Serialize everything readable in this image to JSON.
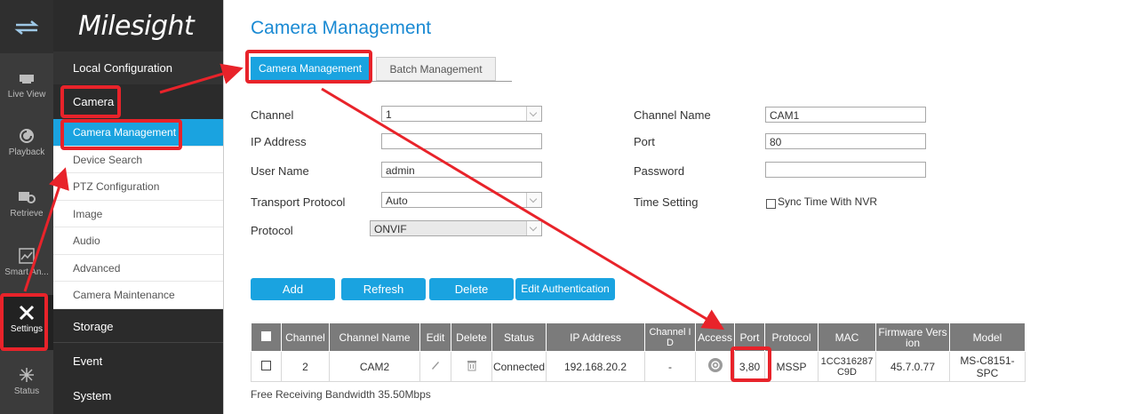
{
  "rail": {
    "items": [
      {
        "label": "Live View",
        "icon": "live-view-icon"
      },
      {
        "label": "Playback",
        "icon": "playback-icon"
      },
      {
        "label": "Retrieve",
        "icon": "retrieve-icon"
      },
      {
        "label": "Smart An...",
        "icon": "smart-analysis-icon"
      },
      {
        "label": "Settings",
        "icon": "settings-icon"
      },
      {
        "label": "Status",
        "icon": "status-icon"
      }
    ]
  },
  "nav": {
    "logo": "Milesight",
    "local_config": "Local Configuration",
    "camera": "Camera",
    "camera_items": [
      "Camera Management",
      "Device Search",
      "PTZ Configuration",
      "Image",
      "Audio",
      "Advanced",
      "Camera Maintenance"
    ],
    "storage": "Storage",
    "event": "Event",
    "system": "System"
  },
  "page": {
    "title": "Camera Management",
    "tabs": [
      "Camera Management",
      "Batch Management"
    ]
  },
  "form": {
    "channel_label": "Channel",
    "channel_value": "1",
    "ip_label": "IP Address",
    "ip_value": "",
    "user_label": "User Name",
    "user_value": "admin",
    "transport_label": "Transport Protocol",
    "transport_value": "Auto",
    "protocol_label": "Protocol",
    "protocol_value": "ONVIF",
    "channel_name_label": "Channel Name",
    "channel_name_value": "CAM1",
    "port_label": "Port",
    "port_value": "80",
    "password_label": "Password",
    "password_value": "",
    "time_label": "Time Setting",
    "sync_label": "Sync Time With NVR"
  },
  "buttons": {
    "add": "Add",
    "refresh": "Refresh",
    "delete": "Delete",
    "edit_auth": "Edit Authentication"
  },
  "table": {
    "headers": [
      "Channel",
      "Channel Name",
      "Edit",
      "Delete",
      "Status",
      "IP Address",
      "Channel I D",
      "Access",
      "Port",
      "Protocol",
      "MAC",
      "Firmware Vers ion",
      "Model"
    ],
    "rows": [
      {
        "channel": "2",
        "name": "CAM2",
        "status": "Connected",
        "ip": "192.168.20.2",
        "channel_id": "-",
        "port": "3,80",
        "protocol": "MSSP",
        "mac": "1CC316287 C9D",
        "firmware": "45.7.0.77",
        "model": "MS-C8151-SPC"
      }
    ]
  },
  "bandwidth": "Free Receiving Bandwidth  35.50Mbps",
  "colors": {
    "accent": "#1aa3e0",
    "highlight": "#e8232a",
    "title": "#1a8ad3"
  }
}
